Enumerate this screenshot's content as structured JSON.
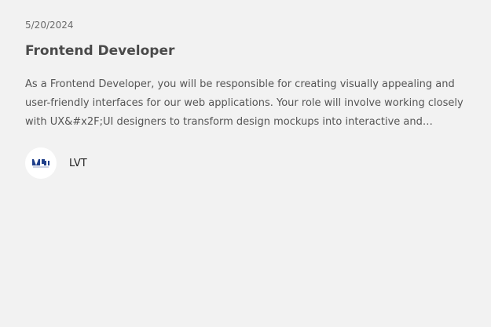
{
  "job": {
    "date": "5/20/2024",
    "title": "Frontend Developer",
    "description": "As a Frontend Developer, you will be responsible for creating visually appealing and user-friendly interfaces for our web applications. Your role will involve working closely with UX&#x2F;UI designers to transform design mockups into interactive and responsive web..."
  },
  "company": {
    "name": "LVT",
    "logo_text": "LVT",
    "logo_color": "#1f3f8a"
  }
}
